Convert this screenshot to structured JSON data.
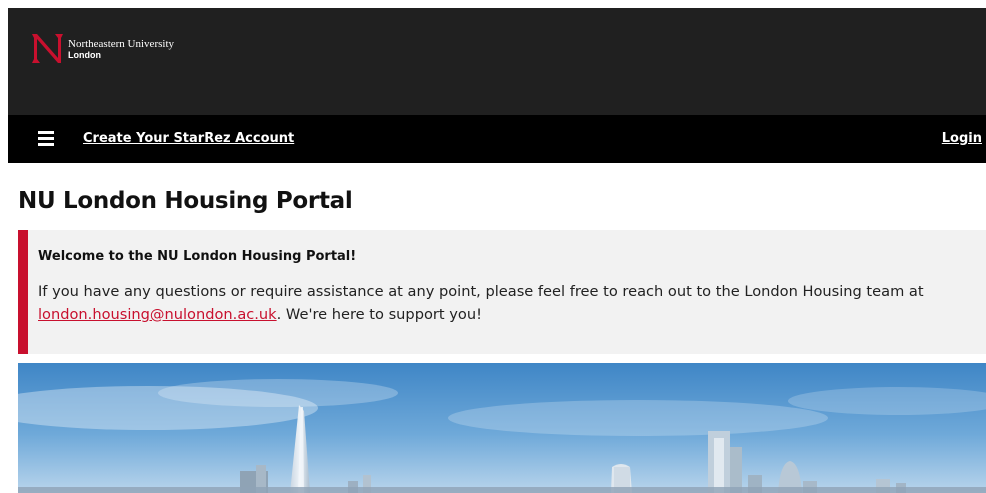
{
  "header": {
    "logo_line1": "Northeastern University",
    "logo_line2": "London"
  },
  "nav": {
    "create_account_label": "Create Your StarRez Account",
    "login_label": "Login"
  },
  "main": {
    "title": "NU London Housing Portal",
    "welcome": {
      "heading": "Welcome to the NU London Housing Portal!",
      "text_before": "If you have any questions or require assistance at any point, please feel free to reach out to the London Housing team at",
      "email": "london.housing@nulondon.ac.uk",
      "text_after": ". We're here to support you!"
    }
  },
  "colors": {
    "header_bg": "#202020",
    "nav_bg": "#000000",
    "brand_red": "#c8102e",
    "welcome_bg": "#f2f2f2"
  },
  "icons": {
    "menu": "hamburger-menu-icon",
    "logo": "northeastern-n-logo"
  }
}
